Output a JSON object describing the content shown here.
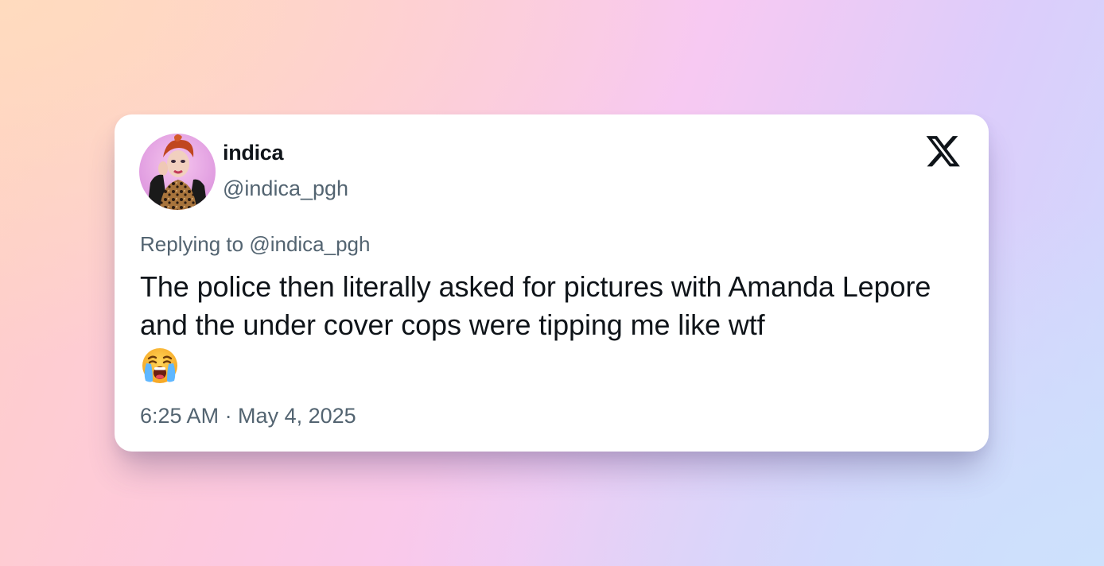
{
  "tweet": {
    "author": {
      "display_name": "indica",
      "handle": "@indica_pgh",
      "avatar": "avatar-photo"
    },
    "platform_icon": "x-logo-icon",
    "reply": {
      "prefix": "Replying to",
      "handle": "@indica_pgh"
    },
    "text": "The police then literally asked for pictures with Amanda Lepore and the under cover cops were tipping me like wtf",
    "emoji": "loudly-crying-face-icon",
    "timestamp": "6:25 AM · May 4, 2025"
  }
}
